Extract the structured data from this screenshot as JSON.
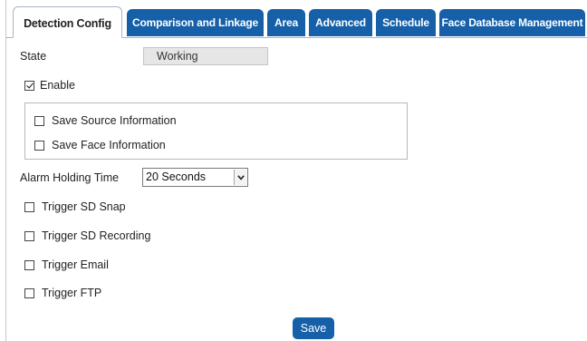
{
  "tabs": [
    {
      "label": "Detection Config",
      "active": true
    },
    {
      "label": "Comparison and Linkage",
      "active": false
    },
    {
      "label": "Area",
      "active": false
    },
    {
      "label": "Advanced",
      "active": false
    },
    {
      "label": "Schedule",
      "active": false
    },
    {
      "label": "Face Database Management",
      "active": false
    }
  ],
  "state": {
    "label": "State",
    "value": "Working"
  },
  "enable": {
    "label": "Enable",
    "checked": true
  },
  "info_options": [
    {
      "label": "Save Source Information",
      "checked": false
    },
    {
      "label": "Save Face Information",
      "checked": false
    }
  ],
  "alarm_holding": {
    "label": "Alarm Holding Time",
    "selected": "20 Seconds"
  },
  "triggers": [
    {
      "label": "Trigger SD Snap",
      "checked": false
    },
    {
      "label": "Trigger SD Recording",
      "checked": false
    },
    {
      "label": "Trigger Email",
      "checked": false
    },
    {
      "label": "Trigger FTP",
      "checked": false
    }
  ],
  "save_label": "Save",
  "colors": {
    "tab_blue": "#1560a8",
    "active_tab_bg": "#ffffff",
    "state_field_bg": "#e6e6e6"
  },
  "icons": {
    "select_arrow": "chevron-down-icon",
    "checkbox_checked": "checkmark-icon"
  }
}
